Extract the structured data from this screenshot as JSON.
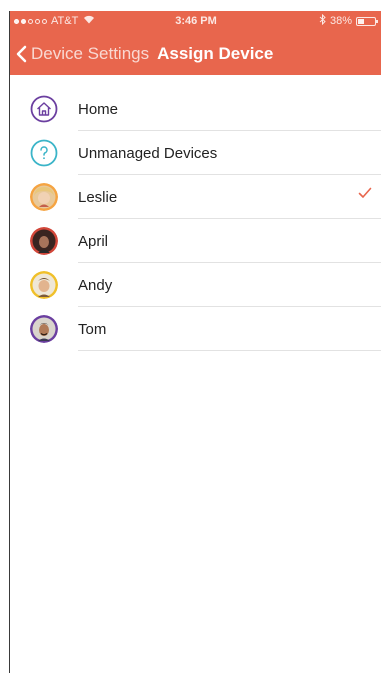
{
  "status_bar": {
    "carrier": "AT&T",
    "time": "3:46 PM",
    "battery": "38%",
    "battery_level": 0.38
  },
  "nav": {
    "back_label": "Device Settings",
    "title": "Assign Device"
  },
  "items": [
    {
      "label": "Home",
      "icon": "home-icon",
      "selected": false
    },
    {
      "label": "Unmanaged Devices",
      "icon": "question-icon",
      "selected": false
    },
    {
      "label": "Leslie",
      "icon": "avatar-leslie",
      "selected": true
    },
    {
      "label": "April",
      "icon": "avatar-april",
      "selected": false
    },
    {
      "label": "Andy",
      "icon": "avatar-andy",
      "selected": false
    },
    {
      "label": "Tom",
      "icon": "avatar-tom",
      "selected": false
    }
  ],
  "colors": {
    "brand": "#e8664d",
    "home_ring": "#6b3fa0",
    "unmanaged_ring": "#3ab4c8",
    "leslie_ring": "#f5a442",
    "april_ring": "#d2473a",
    "andy_ring": "#f0c02a",
    "tom_ring": "#6b3fa0",
    "check": "#e8664d"
  }
}
